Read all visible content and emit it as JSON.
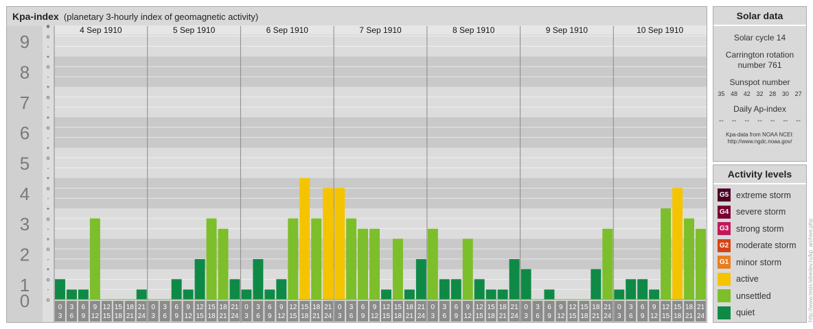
{
  "header": {
    "title": "Kpa-index",
    "subtitle": "(planetary 3-hourly index of geomagnetic activity)"
  },
  "solar": {
    "title": "Solar data",
    "cycle": "Solar cycle 14",
    "carrington": "Carrington rotation number 761",
    "sunspot_label": "Sunspot number",
    "sunspots": [
      "35",
      "48",
      "42",
      "32",
      "28",
      "30",
      "27"
    ],
    "ap_label": "Daily Ap-index",
    "ap_values": [
      "--",
      "--",
      "--",
      "--",
      "--",
      "--",
      "--"
    ],
    "credit_line1": "Kpa-data from NOAA NCEI:",
    "credit_line2": "http://www.ngdc.noaa.gov/"
  },
  "activity": {
    "title": "Activity levels",
    "levels": [
      {
        "badge": "G5",
        "label": "extreme storm",
        "color": "#4d0026"
      },
      {
        "badge": "G4",
        "label": "severe storm",
        "color": "#7a0033"
      },
      {
        "badge": "G3",
        "label": "strong storm",
        "color": "#c2185b"
      },
      {
        "badge": "G2",
        "label": "moderate storm",
        "color": "#d84315"
      },
      {
        "badge": "G1",
        "label": "minor storm",
        "color": "#e67e22"
      },
      {
        "badge": "",
        "label": "active",
        "color": "#f5c400"
      },
      {
        "badge": "",
        "label": "unsettled",
        "color": "#7dbe2b"
      },
      {
        "badge": "",
        "label": "quiet",
        "color": "#0e8a46"
      }
    ]
  },
  "watermark": "http://www.tesis.lebedev.ru/kp_archive.php",
  "chart_data": {
    "type": "bar",
    "ylim": [
      0,
      9
    ],
    "y_major_labels": [
      "0",
      "1",
      "2",
      "3",
      "4",
      "5",
      "6",
      "7",
      "8",
      "9"
    ],
    "y_minor_labels": [
      "+",
      "o",
      "-"
    ],
    "days": [
      "4 Sep 1910",
      "5 Sep 1910",
      "6 Sep 1910",
      "7 Sep 1910",
      "8 Sep 1910",
      "9 Sep 1910",
      "10 Sep 1910"
    ],
    "interval_start_labels": [
      "0",
      "3",
      "6",
      "9",
      "12",
      "15",
      "18",
      "21"
    ],
    "interval_end_labels": [
      "3",
      "6",
      "9",
      "12",
      "15",
      "18",
      "21",
      "24"
    ],
    "colors": {
      "quiet": "#0e8a46",
      "unsettled": "#7dbe2b",
      "active": "#f5c400"
    },
    "values": [
      0.67,
      0.33,
      0.33,
      2.67,
      0,
      0,
      0,
      0.33,
      0,
      0,
      0.67,
      0.33,
      1.33,
      2.67,
      2.33,
      0.67,
      0.33,
      1.33,
      0.33,
      0.67,
      2.67,
      4.0,
      2.67,
      3.67,
      3.67,
      2.67,
      2.33,
      2.33,
      0.33,
      2.0,
      0.33,
      1.33,
      2.33,
      0.67,
      0.67,
      2.0,
      0.67,
      0.33,
      0.33,
      1.33,
      1.0,
      0,
      0.33,
      0,
      0,
      0,
      1.0,
      2.33,
      0.33,
      0.67,
      0.67,
      0.33,
      3.0,
      3.67,
      2.67,
      2.33
    ]
  }
}
